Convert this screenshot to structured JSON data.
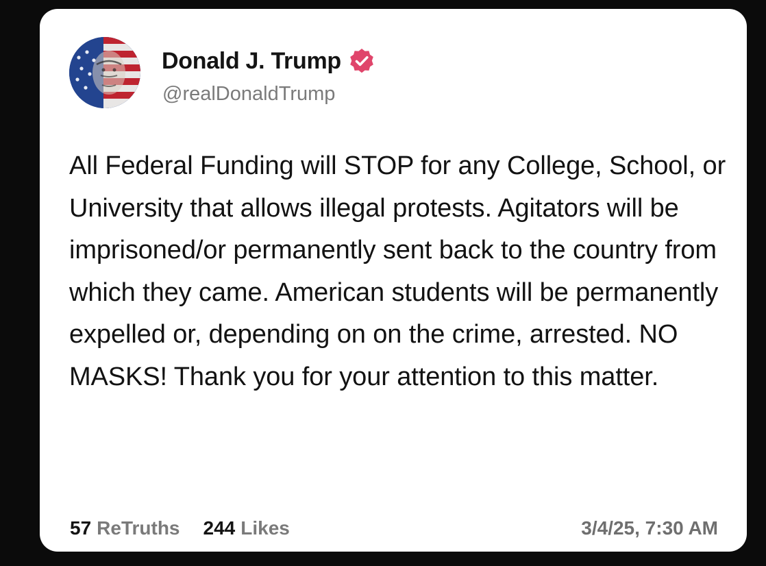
{
  "post": {
    "author": {
      "display_name": "Donald J. Trump",
      "handle": "@realDonaldTrump",
      "verified_icon": "verified-badge-icon",
      "avatar": "avatar-image"
    },
    "text": "All Federal Funding will STOP for any College, School, or University that allows illegal protests. Agitators will be imprisoned/or permanently sent back to the country from which they came. American students will be permanently expelled or, depending on on the crime, arrested. NO MASKS! Thank you for your attention to this matter.",
    "retruths_count": "57",
    "retruths_label": "ReTruths",
    "likes_count": "244",
    "likes_label": "Likes",
    "timestamp": "3/4/25, 7:30 AM"
  },
  "colors": {
    "page_background": "#0b0b0b",
    "card_background": "#ffffff",
    "verified_badge": "#e0456b",
    "muted_text": "#7a7a7a"
  }
}
